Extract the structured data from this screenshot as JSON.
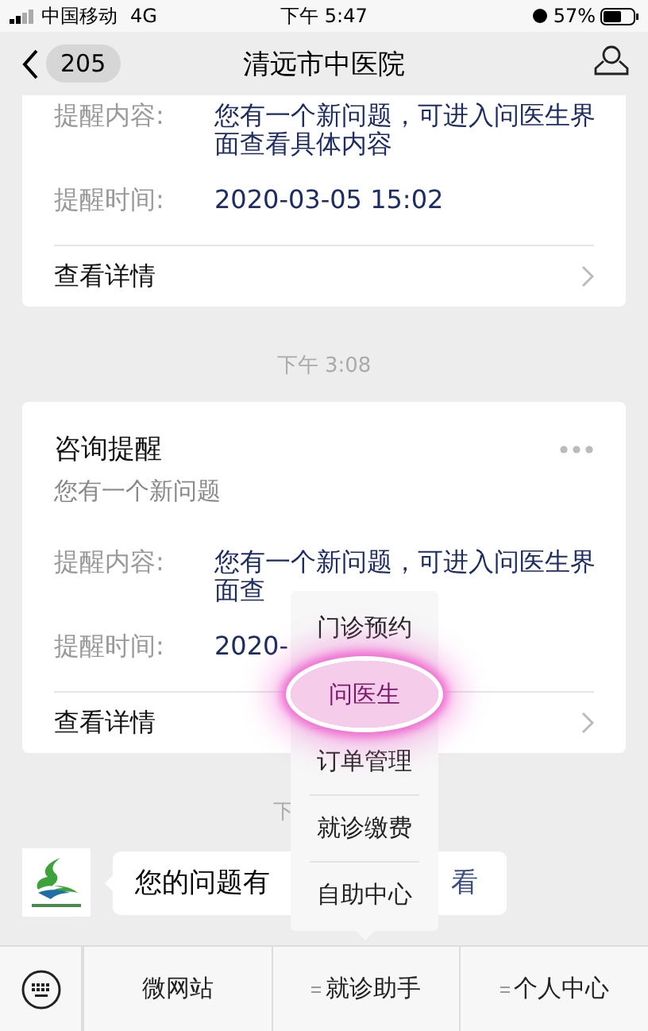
{
  "status_bar": {
    "carrier": "中国移动",
    "network": "4G",
    "time": "下午 5:47",
    "battery": "57%"
  },
  "nav": {
    "back_count": "205",
    "title": "清远市中医院"
  },
  "cards": [
    {
      "fields": [
        {
          "label": "提醒内容:",
          "value": "您有一个新问题，可进入问医生界面查看具体内容"
        },
        {
          "label": "提醒时间:",
          "value": "2020-03-05 15:02"
        }
      ],
      "details": "查看详情",
      "timestamp": "下午 3:08"
    },
    {
      "title": "咨询提醒",
      "subtitle": "您有一个新问题",
      "fields": [
        {
          "label": "提醒内容:",
          "value": "您有一个新问题，可进入问医生界面查"
        },
        {
          "label": "提醒时间:",
          "value": "2020-"
        }
      ],
      "details": "查看详情",
      "timestamp": "下"
    }
  ],
  "message": {
    "text_start": "您的问题有",
    "text_end": "看"
  },
  "menu": [
    {
      "label": "门诊预约",
      "highlighted": false
    },
    {
      "label": "问医生",
      "highlighted": true
    },
    {
      "label": "订单管理",
      "highlighted": false
    },
    {
      "label": "就诊缴费",
      "highlighted": false
    },
    {
      "label": "自助中心",
      "highlighted": false
    }
  ],
  "tabs": [
    {
      "label": "微网站",
      "has_menu": false
    },
    {
      "label": "就诊助手",
      "has_menu": true
    },
    {
      "label": "个人中心",
      "has_menu": true
    }
  ]
}
